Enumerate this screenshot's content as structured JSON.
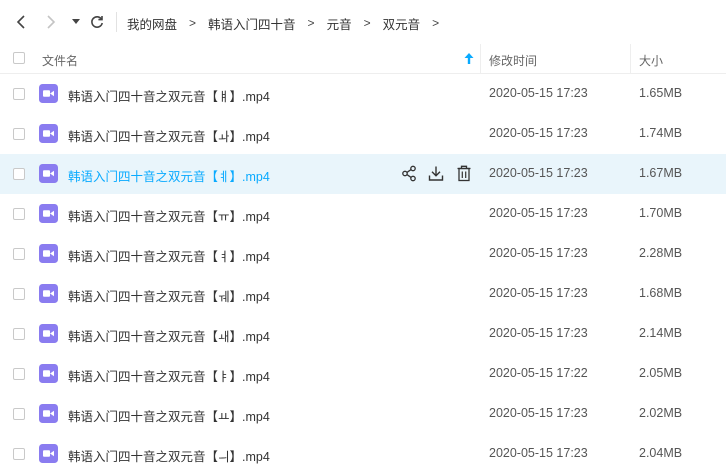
{
  "breadcrumb": [
    "我的网盘",
    "韩语入门四十音",
    "元音",
    "双元音"
  ],
  "breadcrumb_sep": ">",
  "columns": {
    "name": "文件名",
    "time": "修改时间",
    "size": "大小"
  },
  "rows": [
    {
      "name": "韩语入门四十音之双元音【ㅒ】.mp4",
      "time": "2020-05-15 17:23",
      "size": "1.65MB"
    },
    {
      "name": "韩语入门四十音之双元音【ㅘ】.mp4",
      "time": "2020-05-15 17:23",
      "size": "1.74MB"
    },
    {
      "name": "韩语入门四十音之双元音【ㅖ】.mp4",
      "time": "2020-05-15 17:23",
      "size": "1.67MB"
    },
    {
      "name": "韩语入门四十音之双元音【ㅠ】.mp4",
      "time": "2020-05-15 17:23",
      "size": "1.70MB"
    },
    {
      "name": "韩语入门四十音之双元音【ㅕ】.mp4",
      "time": "2020-05-15 17:23",
      "size": "2.28MB"
    },
    {
      "name": "韩语入门四十音之双元音【ㅞ】.mp4",
      "time": "2020-05-15 17:23",
      "size": "1.68MB"
    },
    {
      "name": "韩语入门四十音之双元音【ㅙ】.mp4",
      "time": "2020-05-15 17:23",
      "size": "2.14MB"
    },
    {
      "name": "韩语入门四十音之双元音【ㅑ】.mp4",
      "time": "2020-05-15 17:22",
      "size": "2.05MB"
    },
    {
      "name": "韩语入门四十音之双元音【ㅛ】.mp4",
      "time": "2020-05-15 17:23",
      "size": "2.02MB"
    },
    {
      "name": "韩语入门四十音之双元音【ㅢ】.mp4",
      "time": "2020-05-15 17:23",
      "size": "2.04MB"
    }
  ],
  "colors": {
    "highlight_bg": "#e9f5fb",
    "accent": "#09aaff",
    "video_icon": "#8a7cf0"
  }
}
